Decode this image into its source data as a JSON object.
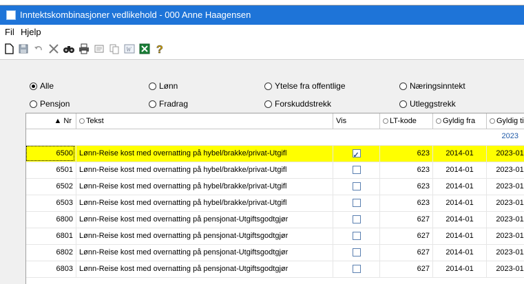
{
  "window": {
    "title": "Inntektskombinasjoner vedlikehold - 000 Anne Haagensen"
  },
  "menu": [
    "Fil",
    "Hjelp"
  ],
  "toolbar": [
    "new-document-icon",
    "save-icon",
    "undo-icon",
    "delete-icon",
    "find-icon",
    "print-icon",
    "print-preview-icon",
    "copy-icon",
    "word-export-icon",
    "excel-export-icon",
    "help-icon"
  ],
  "filters": [
    {
      "label": "Alle",
      "selected": true
    },
    {
      "label": "Lønn",
      "selected": false
    },
    {
      "label": "Ytelse fra offentlige",
      "selected": false
    },
    {
      "label": "Næringsinntekt",
      "selected": false
    },
    {
      "label": "Pensjon",
      "selected": false
    },
    {
      "label": "Fradrag",
      "selected": false
    },
    {
      "label": "Forskuddstrekk",
      "selected": false
    },
    {
      "label": "Utleggstrekk",
      "selected": false
    }
  ],
  "grid": {
    "columns": [
      "Nr",
      "Tekst",
      "Vis",
      "LT-kode",
      "Gyldig fra",
      "Gyldig til"
    ],
    "filter_value": "2023",
    "rows": [
      {
        "nr": "6500",
        "tekst": "Lønn-Reise kost med overnatting på hybel/brakke/privat-Utgifl",
        "vis": true,
        "lt": "623",
        "fra": "2014-01",
        "til": "2023-01",
        "selected": true
      },
      {
        "nr": "6501",
        "tekst": "Lønn-Reise kost med overnatting på hybel/brakke/privat-Utgifl",
        "vis": false,
        "lt": "623",
        "fra": "2014-01",
        "til": "2023-01",
        "selected": false
      },
      {
        "nr": "6502",
        "tekst": "Lønn-Reise kost med overnatting på hybel/brakke/privat-Utgifl",
        "vis": false,
        "lt": "623",
        "fra": "2014-01",
        "til": "2023-01",
        "selected": false
      },
      {
        "nr": "6503",
        "tekst": "Lønn-Reise kost med overnatting på hybel/brakke/privat-Utgifl",
        "vis": false,
        "lt": "623",
        "fra": "2014-01",
        "til": "2023-01",
        "selected": false
      },
      {
        "nr": "6800",
        "tekst": "Lønn-Reise kost med overnatting på pensjonat-Utgiftsgodtgjør",
        "vis": false,
        "lt": "627",
        "fra": "2014-01",
        "til": "2023-01",
        "selected": false
      },
      {
        "nr": "6801",
        "tekst": "Lønn-Reise kost med overnatting på pensjonat-Utgiftsgodtgjør",
        "vis": false,
        "lt": "627",
        "fra": "2014-01",
        "til": "2023-01",
        "selected": false
      },
      {
        "nr": "6802",
        "tekst": "Lønn-Reise kost med overnatting på pensjonat-Utgiftsgodtgjør",
        "vis": false,
        "lt": "627",
        "fra": "2014-01",
        "til": "2023-01",
        "selected": false
      },
      {
        "nr": "6803",
        "tekst": "Lønn-Reise kost med overnatting på pensjonat-Utgiftsgodtgjør",
        "vis": false,
        "lt": "627",
        "fra": "2014-01",
        "til": "2023-01",
        "selected": false
      }
    ]
  },
  "colors": {
    "titlebar": "#1e74d8",
    "selected_row": "#ffff00",
    "filter_text": "#1f5aa8"
  }
}
